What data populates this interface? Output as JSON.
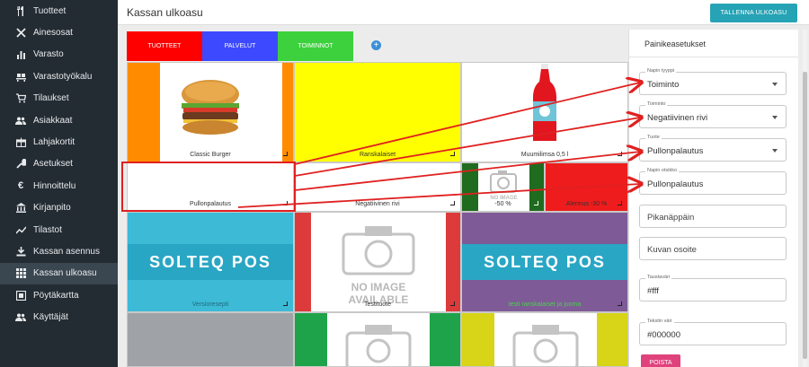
{
  "sidebar": {
    "items": [
      {
        "label": "Tuotteet",
        "icon": "utensils-icon"
      },
      {
        "label": "Ainesosat",
        "icon": "cross-utensils-icon"
      },
      {
        "label": "Varasto",
        "icon": "bar-chart-icon"
      },
      {
        "label": "Varastotyökalu",
        "icon": "pallet-icon"
      },
      {
        "label": "Tilaukset",
        "icon": "cart-icon"
      },
      {
        "label": "Asiakkaat",
        "icon": "users-icon"
      },
      {
        "label": "Lahjakortit",
        "icon": "gift-card-icon"
      },
      {
        "label": "Asetukset",
        "icon": "wrench-icon"
      },
      {
        "label": "Hinnoittelu",
        "icon": "euro-icon"
      },
      {
        "label": "Kirjanpito",
        "icon": "bank-icon"
      },
      {
        "label": "Tilastot",
        "icon": "line-chart-icon"
      },
      {
        "label": "Kassan asennus",
        "icon": "download-icon"
      },
      {
        "label": "Kassan ulkoasu",
        "icon": "grid-icon"
      },
      {
        "label": "Pöytäkartta",
        "icon": "table-map-icon"
      },
      {
        "label": "Käyttäjät",
        "icon": "users-icon"
      }
    ]
  },
  "header": {
    "title": "Kassan ulkoasu",
    "save_label": "TALLENNA ULKOASU"
  },
  "tabs": [
    {
      "label": "TUOTTEET",
      "color": "#ff0000"
    },
    {
      "label": "PALVELUT",
      "color": "#3d49ff"
    },
    {
      "label": "TOIMINNOT",
      "color": "#3dd13d"
    }
  ],
  "tab_add": "+",
  "tiles": {
    "classic_burger": "Classic Burger",
    "ranskalaiset": "Ranskalaiset",
    "muumilimsa": "Muumilimsa 0,5 l",
    "pullonpalautus": "Pullonpalautus",
    "negatiivinen": "Negatiivinen rivi",
    "fifty": "-50 %",
    "alennus": "Alennus -30 %",
    "versioresepti": "Versioresepti",
    "testituote": "Testituote",
    "testi_ranskalaiset": "testi ranskalaiset ja juoma",
    "solteq": "SOLTEQ POS",
    "noimg_top": "NO IMAGE",
    "noimg_bottom": "AVAILABLE"
  },
  "panel": {
    "title": "Painikeasetukset",
    "fields": {
      "napin_tyyppi": {
        "label": "Napin tyyppi",
        "value": "Toiminto"
      },
      "toiminto": {
        "label": "Toiminto",
        "value": "Negatiivinen rivi"
      },
      "tuote": {
        "label": "Tuote",
        "value": "Pullonpalautus"
      },
      "napin_otsikko": {
        "label": "Napin otsikko",
        "value": "Pullonpalautus"
      },
      "pikanappain": {
        "placeholder": "Pikanäppäin"
      },
      "kuvan_osoite": {
        "placeholder": "Kuvan osoite"
      },
      "taustavari": {
        "label": "Taustaväri",
        "value": "#fff"
      },
      "tekstin_vari": {
        "label": "Tekstin väri",
        "value": "#000000"
      }
    },
    "delete_label": "POISTA"
  },
  "colors": {
    "sidebar_bg": "#232c33",
    "accent": "#26a3b5",
    "annotation_red": "#e02020",
    "delete": "#e0427c"
  }
}
